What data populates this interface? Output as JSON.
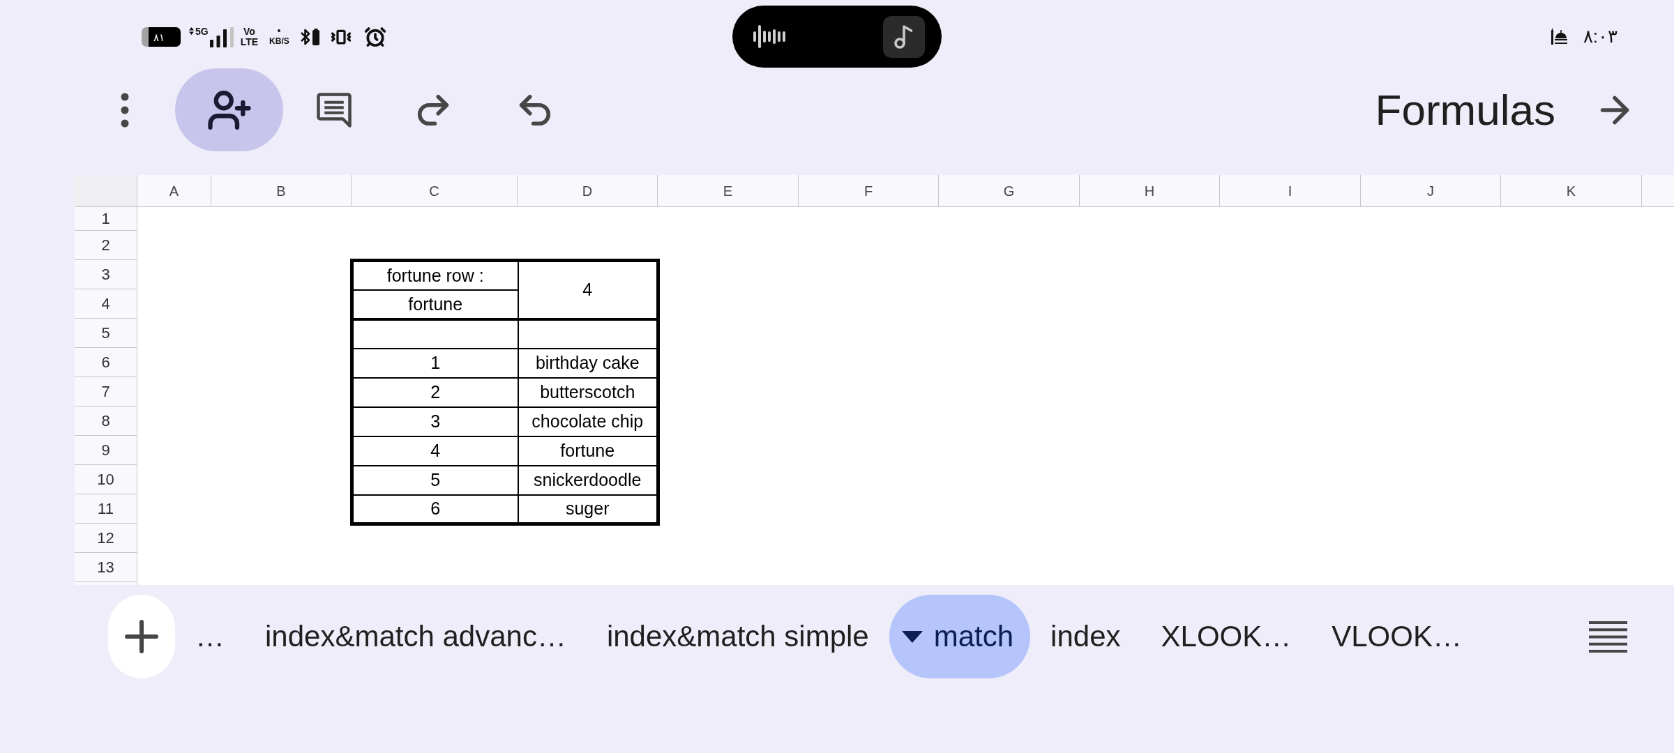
{
  "status_bar": {
    "battery": "٨١",
    "network": "5G",
    "volte": "Vo LTE",
    "speed_unit": "KB/S",
    "time": "٨:٠٣"
  },
  "toolbar": {
    "title": "Formulas"
  },
  "sheet": {
    "columns": [
      "A",
      "B",
      "C",
      "D",
      "E",
      "F",
      "G",
      "H",
      "I",
      "J",
      "K"
    ],
    "rows": [
      "1",
      "2",
      "3",
      "4",
      "5",
      "6",
      "7",
      "8",
      "9",
      "10",
      "11",
      "12",
      "13"
    ],
    "table": {
      "label_row": "fortune row :",
      "label_column": "fortune",
      "result": "4",
      "items": [
        {
          "number": "1",
          "name": "birthday cake"
        },
        {
          "number": "2",
          "name": "butterscotch"
        },
        {
          "number": "3",
          "name": "chocolate chip"
        },
        {
          "number": "4",
          "name": "fortune"
        },
        {
          "number": "5",
          "name": "snickerdoodle"
        },
        {
          "number": "6",
          "name": "suger"
        }
      ]
    }
  },
  "sheet_tabs": [
    {
      "label": "…",
      "selected": false
    },
    {
      "label": "index&match advanc…",
      "selected": false
    },
    {
      "label": "index&match simple",
      "selected": false
    },
    {
      "label": "match",
      "selected": true
    },
    {
      "label": "index",
      "selected": false
    },
    {
      "label": "XLOOK…",
      "selected": false
    },
    {
      "label": "VLOOK…",
      "selected": false
    }
  ]
}
